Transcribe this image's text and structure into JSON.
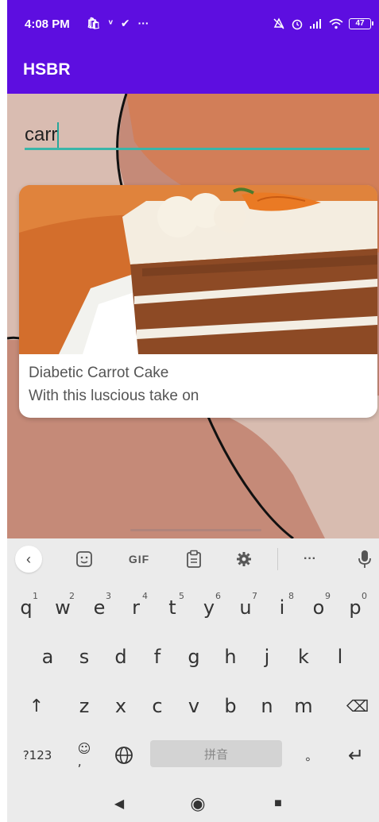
{
  "status_bar": {
    "time": "4:08 PM",
    "left_icons": [
      "shopping-bag-icon",
      "call-icon",
      "check-circle-icon",
      "more-dots-icon"
    ],
    "left_glyphs": [
      "🛍",
      "ᵛ",
      "✔",
      "···"
    ],
    "right_icons": [
      "mute-icon",
      "alarm-icon",
      "signal-icon",
      "wifi-icon"
    ],
    "battery": "47"
  },
  "app_bar": {
    "title": "HSBR",
    "color": "#5d0ee0"
  },
  "search": {
    "value": "carr",
    "underline_color": "#3ab5a8"
  },
  "results": [
    {
      "title": "Diabetic Carrot Cake",
      "description": "With this luscious take on"
    }
  ],
  "keyboard": {
    "toolbar": {
      "back": "‹",
      "gif": "GIF",
      "more": "···"
    },
    "row1": [
      {
        "char": "q",
        "hint": "1"
      },
      {
        "char": "w",
        "hint": "2"
      },
      {
        "char": "e",
        "hint": "3"
      },
      {
        "char": "r",
        "hint": "4"
      },
      {
        "char": "t",
        "hint": "5"
      },
      {
        "char": "y",
        "hint": "6"
      },
      {
        "char": "u",
        "hint": "7"
      },
      {
        "char": "i",
        "hint": "8"
      },
      {
        "char": "o",
        "hint": "9"
      },
      {
        "char": "p",
        "hint": "0"
      }
    ],
    "row2": [
      "a",
      "s",
      "d",
      "f",
      "g",
      "h",
      "j",
      "k",
      "l"
    ],
    "row3": [
      "z",
      "x",
      "c",
      "v",
      "b",
      "n",
      "m"
    ],
    "shift": "↑",
    "backspace": "⌫",
    "symbols": "?123",
    "emoji_comma": "☺\n,",
    "space_label": "拼音",
    "period": "。",
    "enter": "↵"
  },
  "nav": {
    "back": "◀",
    "home": "◉",
    "recents": "■"
  }
}
